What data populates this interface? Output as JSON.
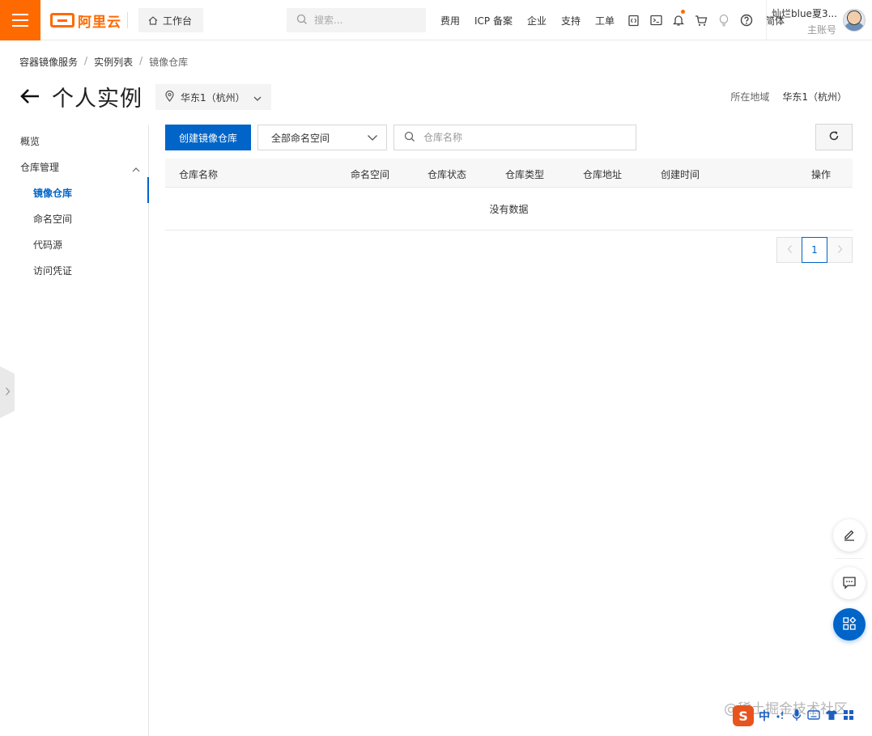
{
  "topbar": {
    "logo_text": "阿里云",
    "workbench_label": "工作台",
    "search_placeholder": "搜索...",
    "links": [
      "费用",
      "ICP 备案",
      "企业",
      "支持",
      "工单"
    ],
    "lang": "简体",
    "user_name": "灿烂blue夏3...",
    "user_role": "主账号"
  },
  "breadcrumb": {
    "items": [
      "容器镜像服务",
      "实例列表",
      "镜像仓库"
    ]
  },
  "header": {
    "title": "个人实例",
    "region_select": "华东1（杭州）",
    "region_label": "所在地域",
    "region_value": "华东1（杭州）"
  },
  "sidebar": {
    "overview": "概览",
    "repo_mgmt": "仓库管理",
    "items": [
      "镜像仓库",
      "命名空间",
      "代码源",
      "访问凭证"
    ]
  },
  "toolbar": {
    "create_label": "创建镜像仓库",
    "namespace_select": "全部命名空间",
    "search_placeholder": "仓库名称"
  },
  "table": {
    "columns": [
      "仓库名称",
      "命名空间",
      "仓库状态",
      "仓库类型",
      "仓库地址",
      "创建时间",
      "操作"
    ],
    "empty_text": "没有数据"
  },
  "pagination": {
    "current_page": "1"
  },
  "watermark": "@稀土掘金技术社区",
  "ime": {
    "logo": "S",
    "mode": "中"
  },
  "colors": {
    "brand": "#ff6a00",
    "primary": "#0064c8"
  }
}
